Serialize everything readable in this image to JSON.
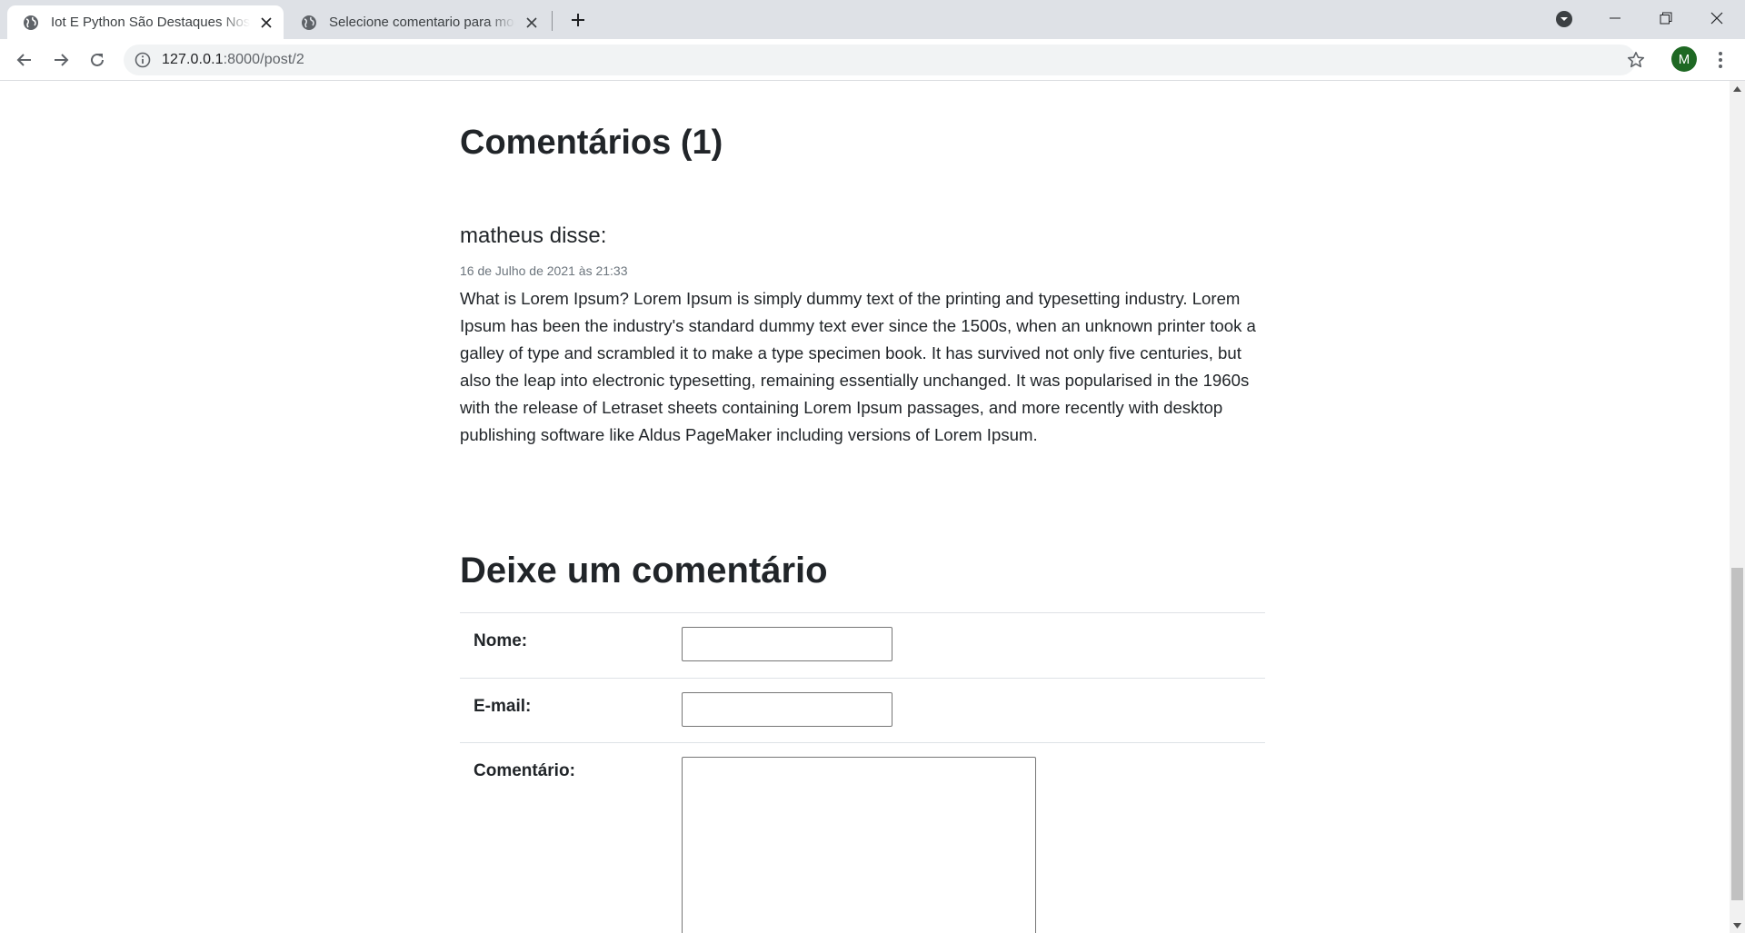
{
  "browser": {
    "tabs": [
      {
        "title": "Iot E Python São Destaques Nos",
        "active": true,
        "icon": "globe-icon"
      },
      {
        "title": "Selecione comentario para modif",
        "active": false,
        "icon": "globe-icon"
      }
    ],
    "url": {
      "host": "127.0.0.1",
      "rest": ":8000/post/2"
    },
    "profile_initial": "M",
    "colors": {
      "tabbar": "#dee1e6",
      "avatar": "#1e6823"
    }
  },
  "page": {
    "comments_heading": "Comentários (1)",
    "comments": [
      {
        "author_line": "matheus disse:",
        "date": "16 de Julho de 2021 às 21:33",
        "body": "What is Lorem Ipsum? Lorem Ipsum is simply dummy text of the printing and typesetting industry. Lorem Ipsum has been the industry's standard dummy text ever since the 1500s, when an unknown printer took a galley of type and scrambled it to make a type specimen book. It has survived not only five centuries, but also the leap into electronic typesetting, remaining essentially unchanged. It was popularised in the 1960s with the release of Letraset sheets containing Lorem Ipsum passages, and more recently with desktop publishing software like Aldus PageMaker including versions of Lorem Ipsum."
      }
    ],
    "form": {
      "heading": "Deixe um comentário",
      "fields": {
        "name_label": "Nome:",
        "name_value": "",
        "email_label": "E-mail:",
        "email_value": "",
        "comment_label": "Comentário:",
        "comment_value": ""
      }
    }
  }
}
